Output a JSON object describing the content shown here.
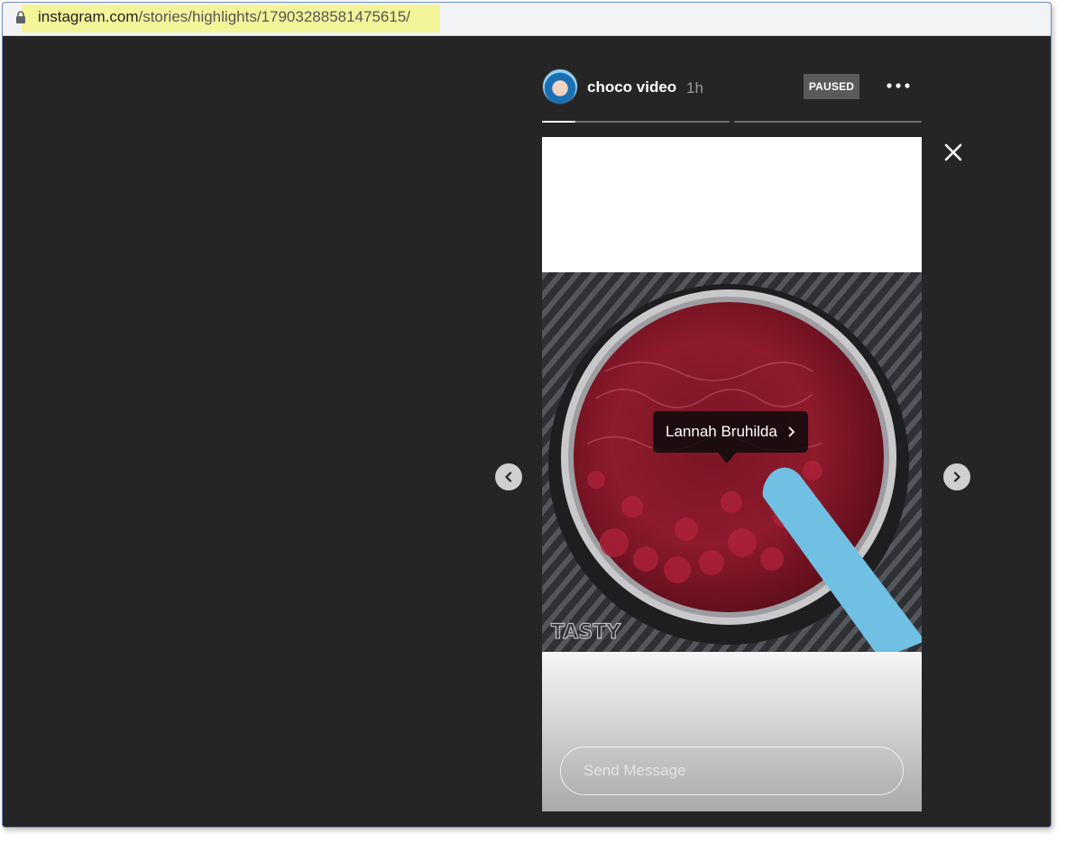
{
  "browser": {
    "url_host": "instagram.com",
    "url_path": "/stories/highlights/17903288581475615/"
  },
  "story": {
    "username": "choco video",
    "time_ago": "1h",
    "status_badge": "PAUSED",
    "progress": [
      {
        "fill": 0.18
      },
      {
        "fill": 0
      },
      {
        "fill": 0
      }
    ],
    "tag_label": "Lannah Bruhilda",
    "watermark": "TASTY",
    "message_placeholder": "Send Message"
  },
  "icons": {
    "lock": "lock-icon",
    "more": "more-icon",
    "close": "close-icon",
    "prev": "chevron-left-icon",
    "next": "chevron-right-icon"
  },
  "colors": {
    "background": "#252525",
    "highlight": "#f4f59a",
    "spatula": "#6fc0e3",
    "jam": "#8e1a2c"
  }
}
